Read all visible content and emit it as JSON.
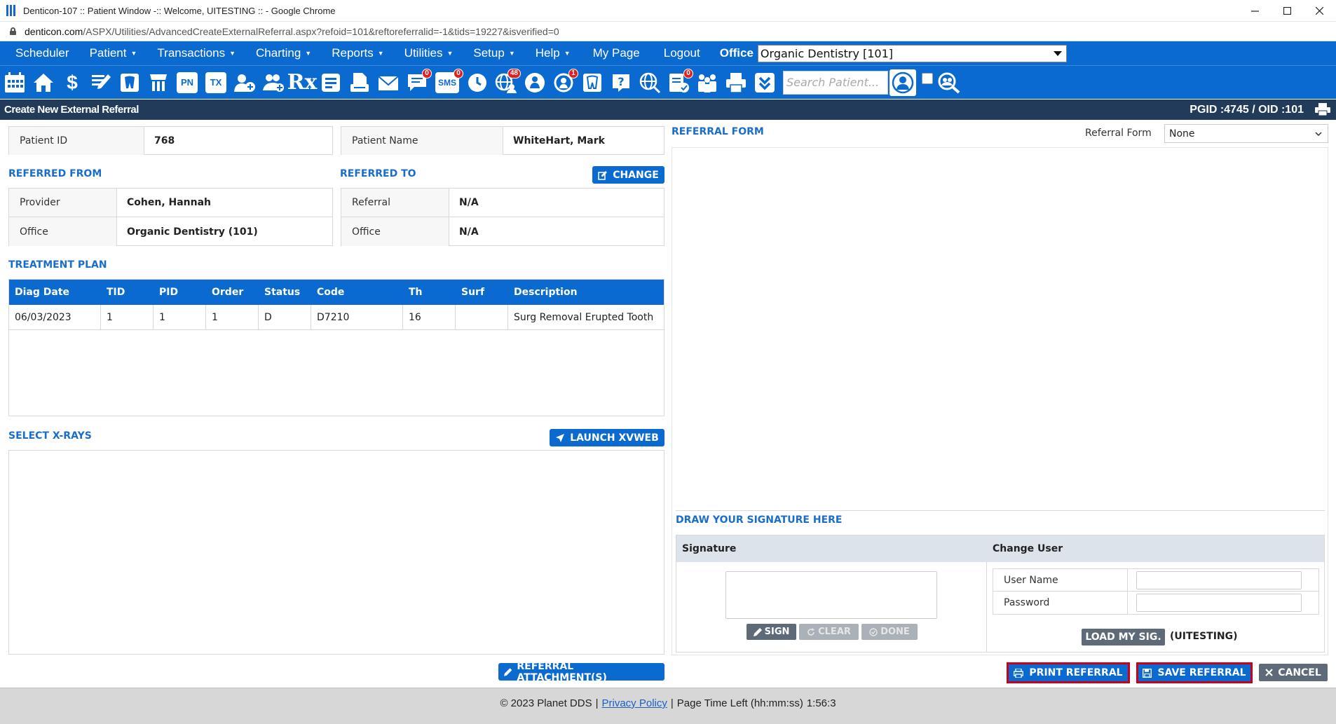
{
  "window": {
    "title": "Denticon-107 :: Patient Window -:: Welcome, UITESTING :: - Google Chrome",
    "url_host": "denticon.com",
    "url_path": "/ASPX/Utilities/AdvancedCreateExternalReferral.aspx?refoid=101&reftoreferralid=-1&tids=19227&isverified=0"
  },
  "menu": {
    "items": [
      {
        "label": "Scheduler",
        "caret": false
      },
      {
        "label": "Patient",
        "caret": true
      },
      {
        "label": "Transactions",
        "caret": true
      },
      {
        "label": "Charting",
        "caret": true
      },
      {
        "label": "Reports",
        "caret": true
      },
      {
        "label": "Utilities",
        "caret": true
      },
      {
        "label": "Setup",
        "caret": true
      },
      {
        "label": "Help",
        "caret": true
      },
      {
        "label": "My Page",
        "caret": false
      },
      {
        "label": "Logout",
        "caret": false
      }
    ],
    "office_label": "Office",
    "office_value": "Organic Dentistry [101]"
  },
  "toolbar": {
    "search_placeholder": "Search Patient...",
    "badges": {
      "messages": "0",
      "sms": "0",
      "online": "48",
      "alerts": "1",
      "forms": "0"
    },
    "icon_labels": {
      "pn": "PN",
      "tx": "TX",
      "rx": "Rx",
      "sms": "SMS"
    }
  },
  "page": {
    "title": "Create New External Referral",
    "ids": "PGID :4745  /  OID :101"
  },
  "patient": {
    "id_label": "Patient ID",
    "id_value": "768",
    "name_label": "Patient Name",
    "name_value": "WhiteHart, Mark"
  },
  "referred_from": {
    "title": "REFERRED FROM",
    "provider_label": "Provider",
    "provider_value": "Cohen, Hannah",
    "office_label": "Office",
    "office_value": "Organic Dentistry (101)"
  },
  "referred_to": {
    "title": "REFERRED TO",
    "change_label": "CHANGE",
    "referral_label": "Referral",
    "referral_value": "N/A",
    "office_label": "Office",
    "office_value": "N/A"
  },
  "treatment_plan": {
    "title": "TREATMENT PLAN",
    "columns": [
      "Diag Date",
      "TID",
      "PID",
      "Order",
      "Status",
      "Code",
      "Th",
      "Surf",
      "Description"
    ],
    "rows": [
      [
        "06/03/2023",
        "1",
        "1",
        "1",
        "D",
        "D7210",
        "16",
        "",
        "Surg Removal Erupted Tooth"
      ]
    ]
  },
  "xrays": {
    "title": "SELECT X-RAYS",
    "launch_label": "LAUNCH XVWEB"
  },
  "referral_form": {
    "title": "REFERRAL FORM",
    "select_label": "Referral Form",
    "select_value": "None"
  },
  "signature": {
    "title": "DRAW YOUR SIGNATURE HERE",
    "col_signature": "Signature",
    "col_change_user": "Change User",
    "sign_label": "SIGN",
    "clear_label": "CLEAR",
    "done_label": "DONE",
    "username_label": "User Name",
    "password_label": "Password",
    "load_sig_label": "LOAD MY SIG.",
    "current_user": "(UITESTING)"
  },
  "actions": {
    "attachments_label": "REFERRAL ATTACHMENT(S)",
    "print_label": "PRINT REFERRAL",
    "save_label": "SAVE REFERRAL",
    "cancel_label": "CANCEL"
  },
  "footer": {
    "copyright": "© 2023 Planet DDS",
    "privacy_label": "Privacy Policy",
    "time_left_label": "Page Time Left (hh:mm:ss)",
    "time_left_value": "1:56:3"
  },
  "colors": {
    "brand_blue": "#0a6ad0",
    "header_navy": "#233b5b",
    "section_blue": "#1a6ec9",
    "highlight_red": "#c8001a"
  }
}
